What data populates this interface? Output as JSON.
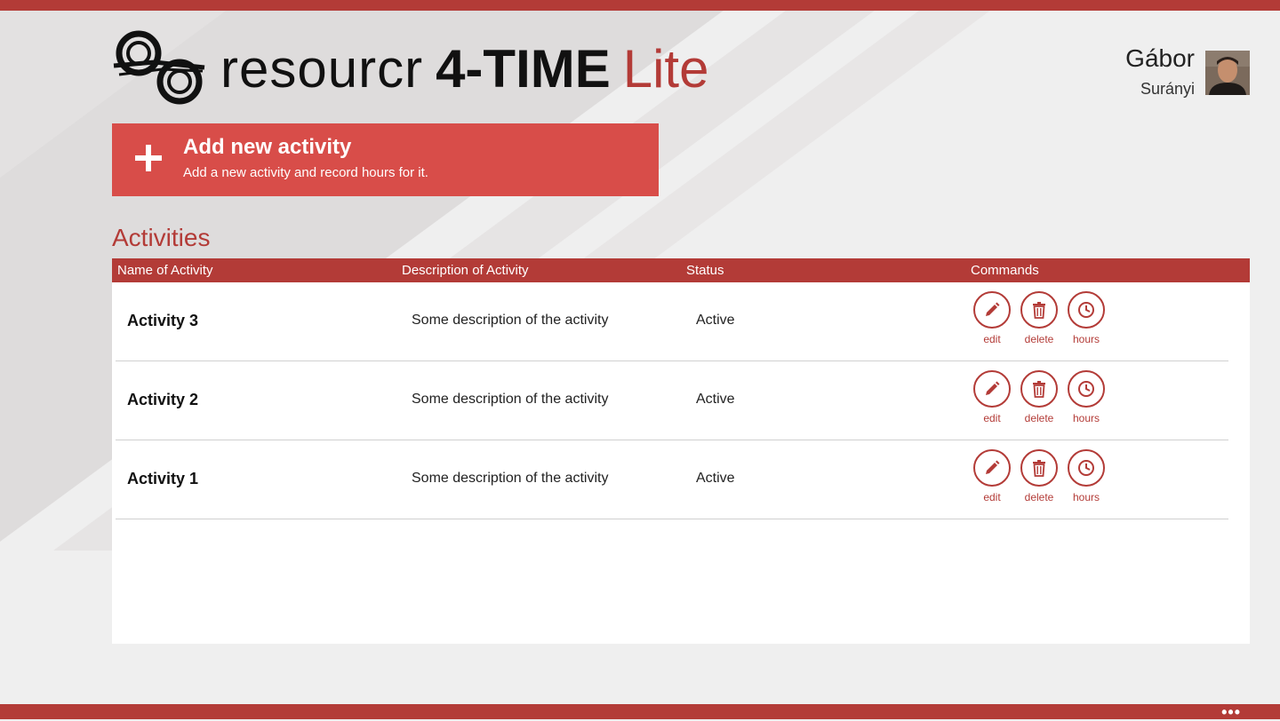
{
  "app": {
    "title_part1": "resourcr",
    "title_part2": "4-TIME",
    "title_part3": "Lite"
  },
  "user": {
    "first_name": "Gábor",
    "last_name": "Surányi"
  },
  "add_activity": {
    "title": "Add new activity",
    "subtitle": "Add a new activity and record hours for it."
  },
  "activities": {
    "section_title": "Activities",
    "columns": {
      "name": "Name of Activity",
      "description": "Description of Activity",
      "status": "Status",
      "commands": "Commands"
    },
    "commands": {
      "edit": "edit",
      "delete": "delete",
      "hours": "hours"
    },
    "rows": [
      {
        "name": "Activity 3",
        "description": "Some description of the activity",
        "status": "Active"
      },
      {
        "name": "Activity 2",
        "description": "Some description of the activity",
        "status": "Active"
      },
      {
        "name": "Activity 1",
        "description": "Some description of the activity",
        "status": "Active"
      }
    ]
  },
  "app_bar": {
    "more": "•••"
  },
  "colors": {
    "accent": "#b33b37",
    "button": "#d84d49",
    "background": "#efefef"
  },
  "icons": [
    "logo-icon",
    "plus-icon",
    "edit-icon",
    "delete-icon",
    "clock-icon",
    "more-icon"
  ]
}
